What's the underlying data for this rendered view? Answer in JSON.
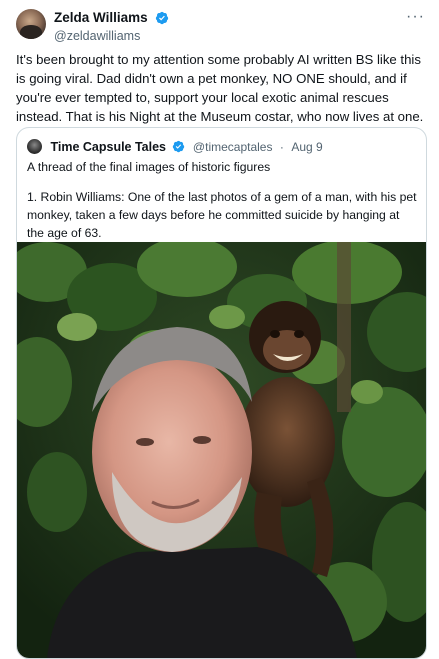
{
  "post": {
    "display_name": "Zelda Williams",
    "handle": "@zeldawilliams",
    "more_label": "···",
    "text": "It's been brought to my attention some probably AI written BS like this is going viral. Dad didn't own a pet monkey, NO ONE should, and if you're ever tempted to, support your local exotic animal rescues instead. That is his Night at the Museum costar, who now lives at one."
  },
  "quote": {
    "display_name": "Time Capsule Tales",
    "handle": "@timecaptales",
    "separator": "·",
    "date": "Aug 9",
    "line1": "A thread of the final images of historic figures",
    "line2": "1. Robin Williams: One of the last photos of a gem of a man, with his pet monkey, taken a few days before he committed suicide by hanging at the age of 63."
  },
  "colors": {
    "verified": "#1d9bf0",
    "secondary_text": "#536471",
    "border": "#cfd9de"
  },
  "icons": {
    "verified": "verified-badge-icon",
    "more": "more-options-icon"
  }
}
